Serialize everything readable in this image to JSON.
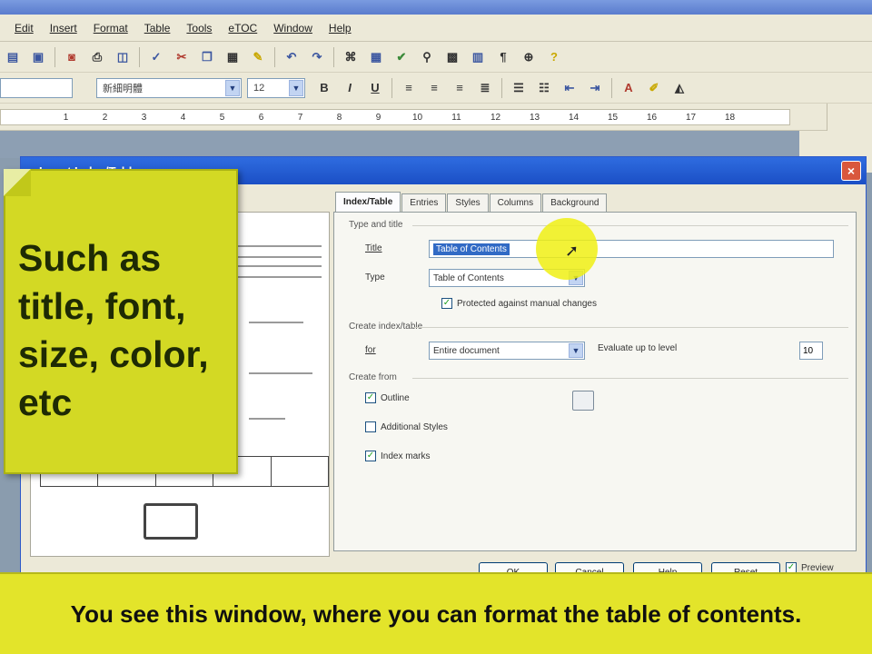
{
  "menu": {
    "items": [
      "Edit",
      "Insert",
      "Format",
      "Table",
      "Tools",
      "eTOC",
      "Window",
      "Help"
    ]
  },
  "format_toolbar": {
    "style_value": "",
    "font_value": "新細明體",
    "size_value": "12"
  },
  "ruler": {
    "ticks": [
      "1",
      "2",
      "3",
      "4",
      "5",
      "6",
      "7",
      "8",
      "9",
      "10",
      "11",
      "12",
      "13",
      "14",
      "15",
      "16",
      "17",
      "18"
    ]
  },
  "dialog": {
    "title": "Insert Index/Table",
    "close_label": "×",
    "tabs": [
      "Index/Table",
      "Entries",
      "Styles",
      "Columns",
      "Background"
    ],
    "type_section": "Type and title",
    "title_label": "Title",
    "title_value": "Table of Contents",
    "type_label": "Type",
    "type_value": "Table of Contents",
    "protected_label": "Protected against manual changes",
    "create_index_section": "Create index/table",
    "for_label": "for",
    "for_value": "Entire document",
    "evaluate_label": "Evaluate up to level",
    "level_value": "10",
    "create_from_section": "Create from",
    "outline_label": "Outline",
    "additional_styles_label": "Additional Styles",
    "index_marks_label": "Index marks",
    "buttons": [
      "OK",
      "Cancel",
      "Help",
      "Reset"
    ],
    "preview_label": "Preview"
  },
  "note": {
    "text": "Such as title, font, size, color, etc"
  },
  "caption": {
    "text": "You see this window, where you can format the table of contents."
  },
  "icons": {
    "toolbar1": [
      "new-icon",
      "save-icon",
      "export-pdf-icon",
      "print-icon",
      "print-preview-icon",
      "spellcheck-icon",
      "cut-icon",
      "copy-icon",
      "paste-icon",
      "format-paintbrush-icon",
      "undo-icon",
      "redo-icon",
      "hyperlink-icon",
      "table-icon",
      "show-draw-icon",
      "find-icon",
      "gallery-icon",
      "data-sources-icon",
      "nonprinting-chars-icon",
      "zoom-icon",
      "help-icon"
    ],
    "toolbar2": [
      "bold-icon",
      "italic-icon",
      "underline-icon",
      "align-left-icon",
      "align-center-icon",
      "align-right-icon",
      "justify-icon",
      "numbering-icon",
      "bullets-icon",
      "decrease-indent-icon",
      "increase-indent-icon",
      "font-color-icon",
      "highlight-icon",
      "background-color-icon"
    ]
  },
  "colors": {
    "note_bg": "#d3d924",
    "caption_bg": "#e3e42a",
    "dialog_title": "#2f6ce0"
  }
}
